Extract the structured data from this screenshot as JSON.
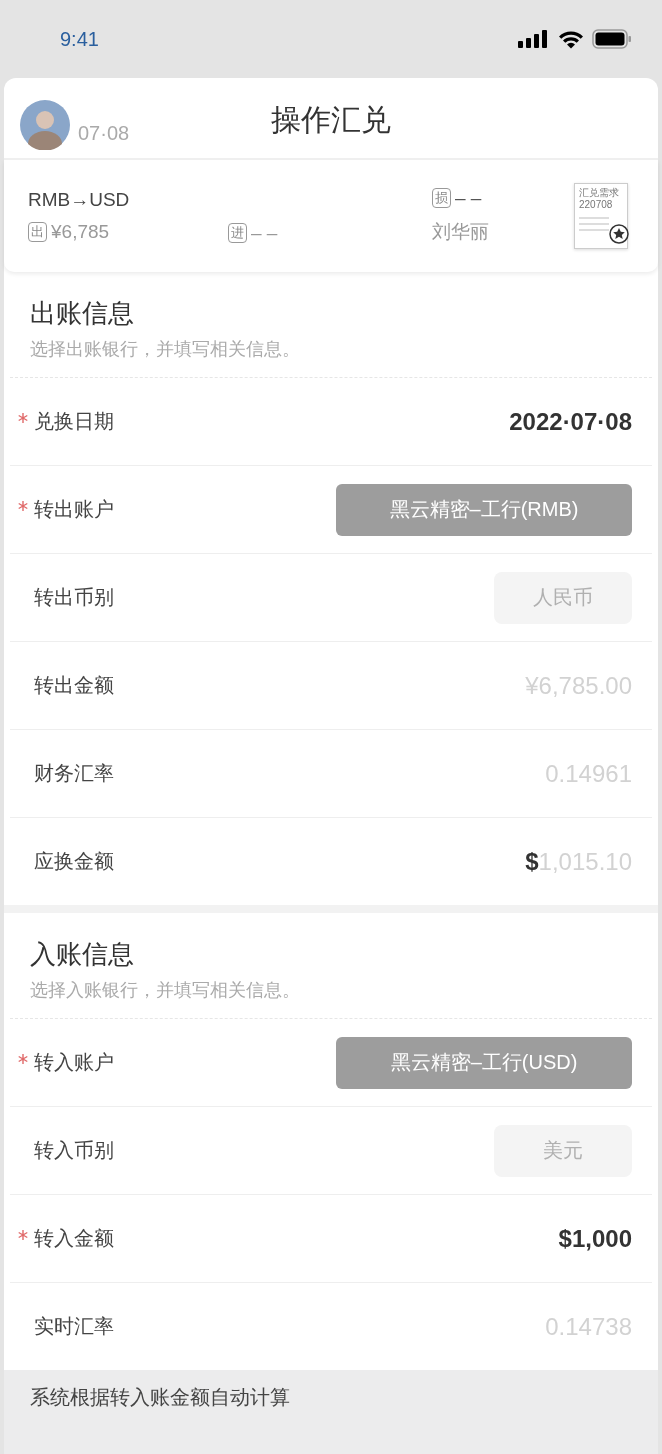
{
  "status_bar": {
    "time": "9:41"
  },
  "header": {
    "date": "07·08",
    "title": "操作汇兑"
  },
  "summary": {
    "pair": "RMB→USD",
    "out_tag": "出",
    "out_amount": "¥6,785",
    "in_tag": "进",
    "in_amount": "– –",
    "loss_tag": "损",
    "loss_amount": "– –",
    "person": "刘华丽",
    "doc_title": "汇兑需求",
    "doc_number": "220708"
  },
  "sections": [
    {
      "title": "出账信息",
      "subtitle": "选择出账银行，并填写相关信息。",
      "rows": [
        {
          "label": "兑换日期",
          "required": true,
          "kind": "value",
          "emphasis": true,
          "value": "2022·07·08"
        },
        {
          "label": "转出账户",
          "required": true,
          "kind": "select",
          "value": "黑云精密–工行(RMB)"
        },
        {
          "label": "转出币别",
          "required": false,
          "kind": "locked",
          "value": "人民币"
        },
        {
          "label": "转出金额",
          "required": false,
          "kind": "value",
          "emphasis": false,
          "value": "¥6,785.00"
        },
        {
          "label": "财务汇率",
          "required": false,
          "kind": "value",
          "emphasis": false,
          "value": "0.14961"
        },
        {
          "label": "应换金额",
          "required": false,
          "kind": "value",
          "emphasis": false,
          "prefix": "$",
          "value": "1,015.10"
        }
      ]
    },
    {
      "title": "入账信息",
      "subtitle": "选择入账银行，并填写相关信息。",
      "rows": [
        {
          "label": "转入账户",
          "required": true,
          "kind": "select",
          "value": "黑云精密–工行(USD)"
        },
        {
          "label": "转入币别",
          "required": false,
          "kind": "locked",
          "value": "美元"
        },
        {
          "label": "转入金额",
          "required": true,
          "kind": "value",
          "emphasis": true,
          "value": "$1,000"
        },
        {
          "label": "实时汇率",
          "required": false,
          "kind": "value",
          "emphasis": false,
          "value": "0.14738"
        }
      ]
    }
  ],
  "footer_note": "系统根据转入账金额自动计算"
}
